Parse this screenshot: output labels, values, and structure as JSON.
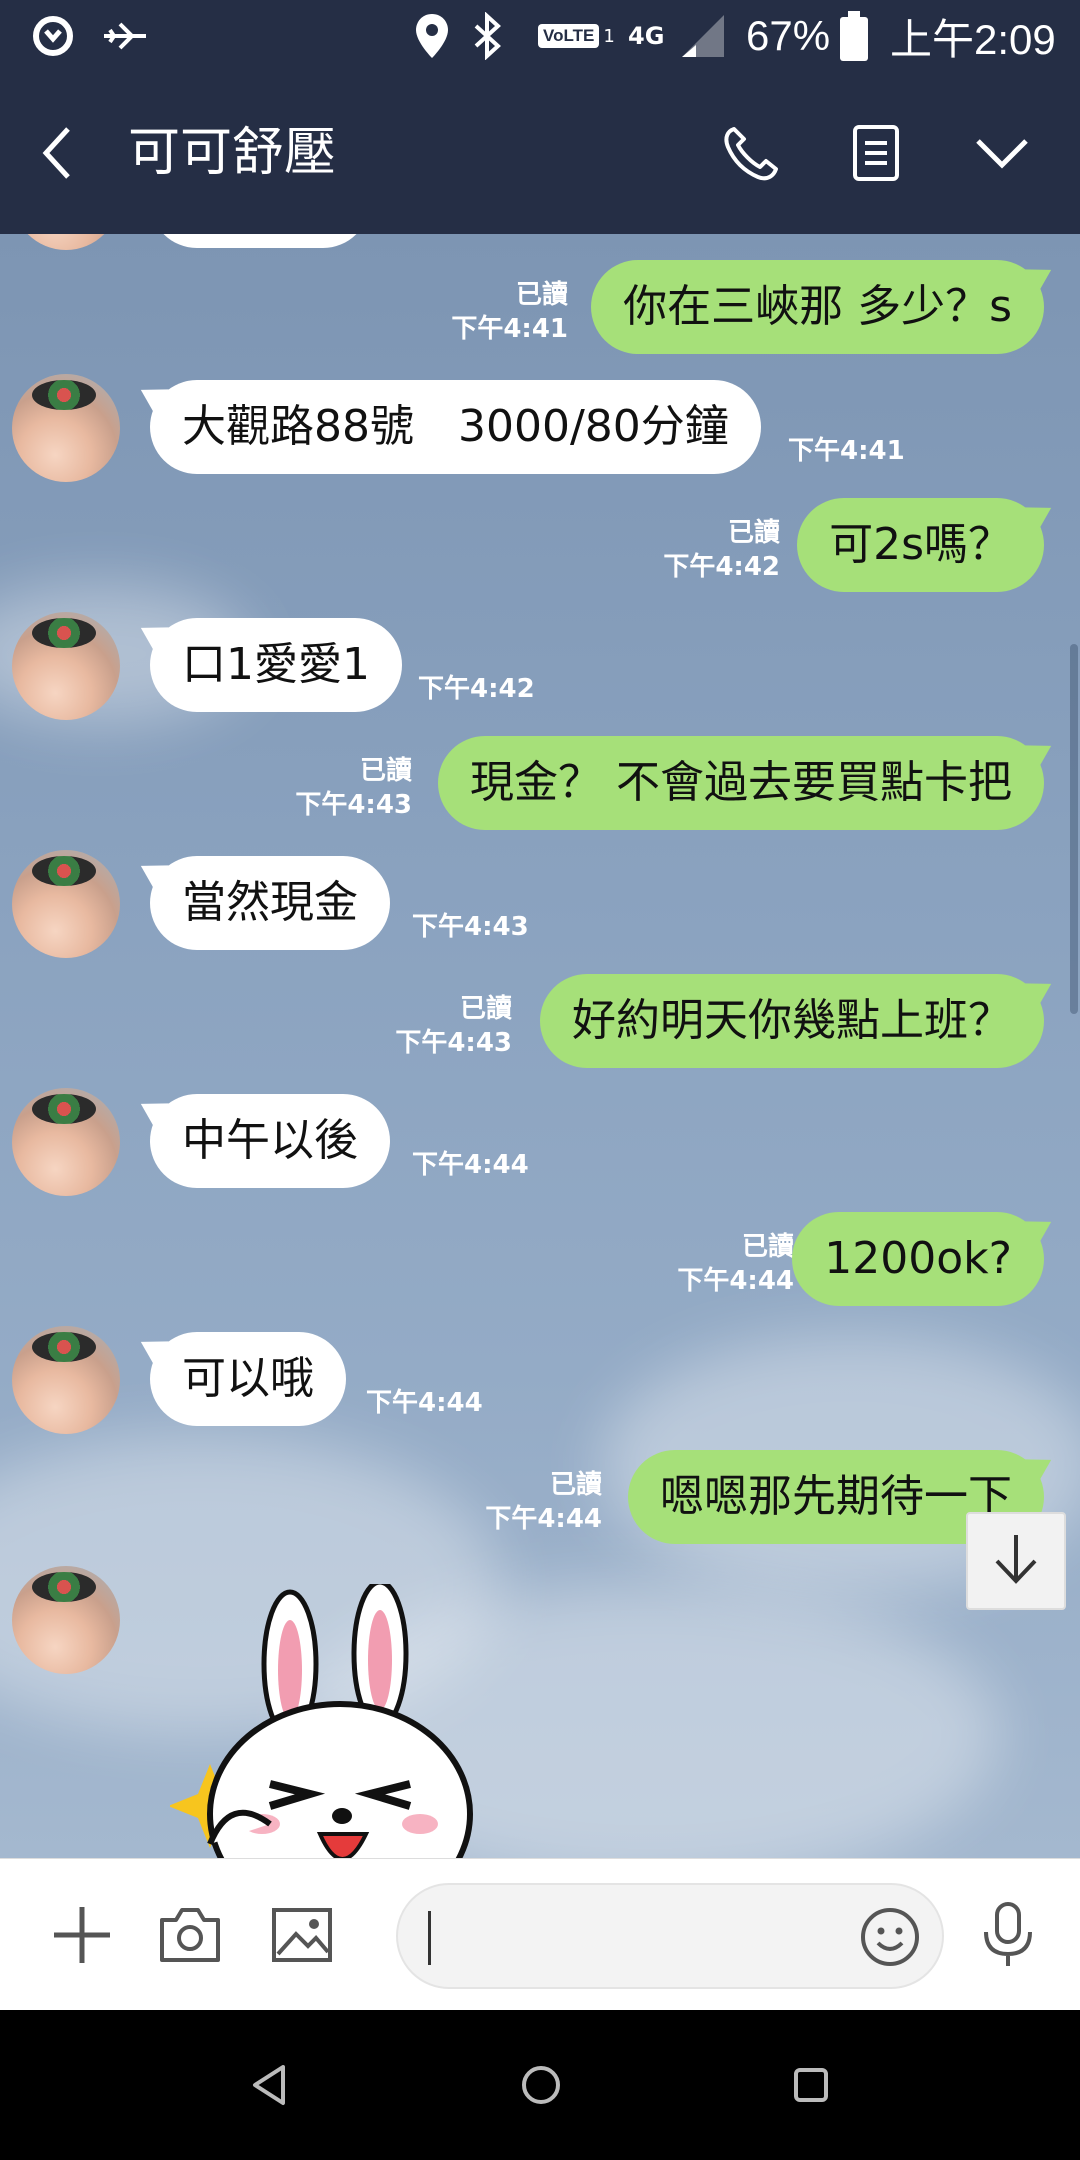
{
  "status_bar": {
    "volte": "VoLTE",
    "volte_sub": "1",
    "network": "4G",
    "battery": "67%",
    "time": "上午2:09"
  },
  "header": {
    "title": "可可舒壓",
    "icons": [
      "back-icon",
      "phone-icon",
      "notes-icon",
      "chevron-down-icon"
    ]
  },
  "messages": [
    {
      "side": "sent",
      "text": "你在三峽那 多少？s",
      "read": "已讀",
      "time": "下午4:41"
    },
    {
      "side": "recv",
      "text": "大觀路88號　3000/80分鐘",
      "time": "下午4:41"
    },
    {
      "side": "sent",
      "text": "可2s嗎？",
      "read": "已讀",
      "time": "下午4:42"
    },
    {
      "side": "recv",
      "text": "口1愛愛1",
      "time": "下午4:42"
    },
    {
      "side": "sent",
      "text": "現金？ 不會過去要買點卡把",
      "read": "已讀",
      "time": "下午4:43"
    },
    {
      "side": "recv",
      "text": "當然現金",
      "time": "下午4:43"
    },
    {
      "side": "sent",
      "text": "好約明天你幾點上班？",
      "read": "已讀",
      "time": "下午4:43"
    },
    {
      "side": "recv",
      "text": "中午以後",
      "time": "下午4:44"
    },
    {
      "side": "sent",
      "text": "1200ok?",
      "read": "已讀",
      "time": "下午4:44"
    },
    {
      "side": "recv",
      "text": "可以哦",
      "time": "下午4:44"
    },
    {
      "side": "sent",
      "text": "嗯嗯那先期待一下",
      "read": "已讀",
      "time": "下午4:44"
    }
  ],
  "sticker": {
    "name": "rabbit-sticker"
  },
  "input": {
    "placeholder": "",
    "icons": [
      "plus-icon",
      "camera-icon",
      "image-icon",
      "emoji-icon",
      "microphone-icon"
    ]
  },
  "navigation": [
    "back-nav-icon",
    "home-nav-icon",
    "recents-nav-icon"
  ],
  "colors": {
    "header": "#252e45",
    "sent_bubble": "#a6e079",
    "recv_bubble": "#ffffff",
    "chat_bg": "#8aa2bf"
  }
}
